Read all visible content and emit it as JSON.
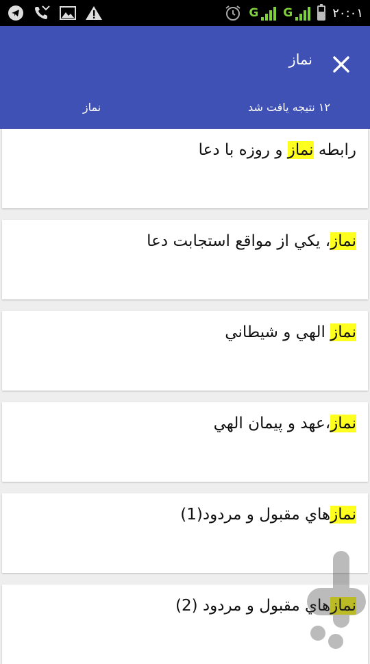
{
  "status_bar": {
    "icons": [
      "telegram-icon",
      "missed-call-icon",
      "image-icon",
      "warning-icon",
      "alarm-icon",
      "signal-icon",
      "signal-icon",
      "battery-icon"
    ],
    "sim1_label": "G",
    "sim2_label": "G",
    "time": "۲۰:۰۱"
  },
  "toolbar": {
    "title": "نماز",
    "close_icon": "close-icon",
    "results_text": "۱۲ نتیجه یافت شد",
    "query": "نماز"
  },
  "results": [
    {
      "before": "رابطه ",
      "match": "نماز",
      "after": " و روزه با دعا"
    },
    {
      "before": "",
      "match": "نماز",
      "after": "، يکي از مواقع استجابت دعا"
    },
    {
      "before": "",
      "match": "نماز",
      "after": " الهي و شيطاني"
    },
    {
      "before": "",
      "match": "نماز",
      "after": "،عهد و پيمان الهي"
    },
    {
      "before": "",
      "match": "نماز",
      "after": "هاي مقبول و مردود(1)"
    },
    {
      "before": "",
      "match": "نماز",
      "after": "هاي مقبول و مردود (2)"
    }
  ],
  "colors": {
    "app_bar": "#3f51b5",
    "highlight": "#ffff1f",
    "background": "#eeeeee"
  },
  "watermark": "bazaar-logo-icon"
}
